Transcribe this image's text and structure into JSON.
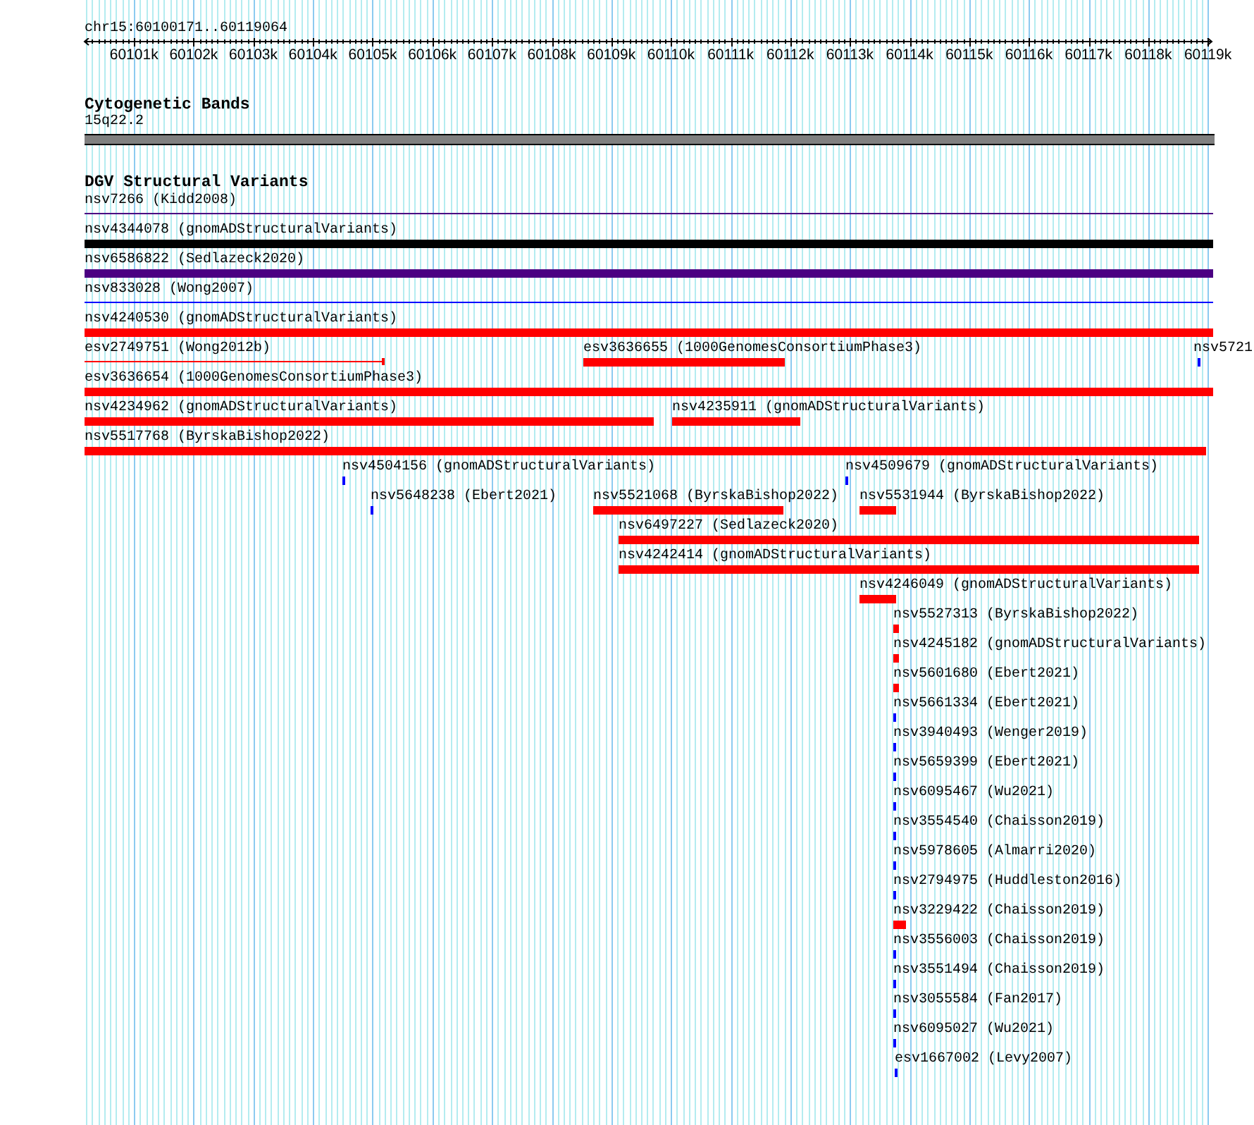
{
  "region": "chr15:60100171..60119064",
  "ruler": {
    "ticks": [
      "60101k",
      "60102k",
      "60103k",
      "60104k",
      "60105k",
      "60106k",
      "60107k",
      "60108k",
      "60109k",
      "60110k",
      "60111k",
      "60112k",
      "60113k",
      "60114k",
      "60115k",
      "60116k",
      "60117k",
      "60118k",
      "60119k"
    ]
  },
  "cytogenetic_bands": {
    "title": "Cytogenetic Bands",
    "band": {
      "label": "15q22.2"
    }
  },
  "variants": {
    "title": "DGV Structural Variants",
    "rows": [
      {
        "features": [
          {
            "label": "nsv7266 (Kidd2008)",
            "kind": "line",
            "color": "#4b0082"
          }
        ]
      },
      {
        "features": [
          {
            "label": "nsv4344078 (gnomADStructuralVariants)",
            "kind": "bar",
            "color": "#000000"
          }
        ]
      },
      {
        "features": [
          {
            "label": "nsv6586822 (Sedlazeck2020)",
            "kind": "bar",
            "color": "#4b0082"
          }
        ]
      },
      {
        "features": [
          {
            "label": "nsv833028 (Wong2007)",
            "kind": "line",
            "color": "#0000ff"
          }
        ]
      },
      {
        "features": [
          {
            "label": "nsv4240530 (gnomADStructuralVariants)",
            "kind": "bar",
            "color": "#ff0000"
          }
        ]
      },
      {
        "features": [
          {
            "label": "esv2749751 (Wong2012b)",
            "kind": "span",
            "color": "#ff0000"
          },
          {
            "label": "esv3636655 (1000GenomesConsortiumPhase3)",
            "kind": "bar",
            "color": "#ff0000"
          },
          {
            "label": "nsv5721",
            "kind": "tick",
            "color": "#0000ff"
          }
        ]
      },
      {
        "features": [
          {
            "label": "esv3636654 (1000GenomesConsortiumPhase3)",
            "kind": "bar",
            "color": "#ff0000"
          }
        ]
      },
      {
        "features": [
          {
            "label": "nsv4234962 (gnomADStructuralVariants)",
            "kind": "bar",
            "color": "#ff0000"
          },
          {
            "label": "nsv4235911 (gnomADStructuralVariants)",
            "kind": "bar",
            "color": "#ff0000"
          }
        ]
      },
      {
        "features": [
          {
            "label": "nsv5517768 (ByrskaBishop2022)",
            "kind": "bar",
            "color": "#ff0000"
          }
        ]
      },
      {
        "features": [
          {
            "label": "nsv4504156 (gnomADStructuralVariants)",
            "kind": "tick",
            "color": "#0000ff"
          },
          {
            "label": "nsv4509679 (gnomADStructuralVariants)",
            "kind": "tick",
            "color": "#0000ff"
          }
        ]
      },
      {
        "features": [
          {
            "label": "nsv5648238 (Ebert2021)",
            "kind": "tick",
            "color": "#0000ff"
          },
          {
            "label": "nsv5521068 (ByrskaBishop2022)",
            "kind": "bar",
            "color": "#ff0000"
          },
          {
            "label": "nsv5531944 (ByrskaBishop2022)",
            "kind": "bar",
            "color": "#ff0000"
          }
        ]
      },
      {
        "features": [
          {
            "label": "nsv6497227 (Sedlazeck2020)",
            "kind": "bar",
            "color": "#ff0000"
          }
        ]
      },
      {
        "features": [
          {
            "label": "nsv4242414 (gnomADStructuralVariants)",
            "kind": "bar",
            "color": "#ff0000"
          }
        ]
      },
      {
        "features": [
          {
            "label": "nsv4246049 (gnomADStructuralVariants)",
            "kind": "bar",
            "color": "#ff0000"
          }
        ]
      },
      {
        "features": [
          {
            "label": "nsv5527313 (ByrskaBishop2022)",
            "kind": "bar",
            "color": "#ff0000"
          }
        ]
      },
      {
        "features": [
          {
            "label": "nsv4245182 (gnomADStructuralVariants)",
            "kind": "bar",
            "color": "#ff0000"
          }
        ]
      },
      {
        "features": [
          {
            "label": "nsv5601680 (Ebert2021)",
            "kind": "bar",
            "color": "#ff0000"
          }
        ]
      },
      {
        "features": [
          {
            "label": "nsv5661334 (Ebert2021)",
            "kind": "tick",
            "color": "#0000ff"
          }
        ]
      },
      {
        "features": [
          {
            "label": "nsv3940493 (Wenger2019)",
            "kind": "tick",
            "color": "#0000ff"
          }
        ]
      },
      {
        "features": [
          {
            "label": "nsv5659399 (Ebert2021)",
            "kind": "tick",
            "color": "#0000ff"
          }
        ]
      },
      {
        "features": [
          {
            "label": "nsv6095467 (Wu2021)",
            "kind": "tick",
            "color": "#0000ff"
          }
        ]
      },
      {
        "features": [
          {
            "label": "nsv3554540 (Chaisson2019)",
            "kind": "tick",
            "color": "#0000ff"
          }
        ]
      },
      {
        "features": [
          {
            "label": "nsv5978605 (Almarri2020)",
            "kind": "tick",
            "color": "#0000ff"
          }
        ]
      },
      {
        "features": [
          {
            "label": "nsv2794975 (Huddleston2016)",
            "kind": "tick",
            "color": "#0000ff"
          }
        ]
      },
      {
        "features": [
          {
            "label": "nsv3229422 (Chaisson2019)",
            "kind": "bar",
            "color": "#ff0000"
          }
        ]
      },
      {
        "features": [
          {
            "label": "nsv3556003 (Chaisson2019)",
            "kind": "tick",
            "color": "#0000ff"
          }
        ]
      },
      {
        "features": [
          {
            "label": "nsv3551494 (Chaisson2019)",
            "kind": "tick",
            "color": "#0000ff"
          }
        ]
      },
      {
        "features": [
          {
            "label": "nsv3055584 (Fan2017)",
            "kind": "tick",
            "color": "#0000ff"
          }
        ]
      },
      {
        "features": [
          {
            "label": "nsv6095027 (Wu2021)",
            "kind": "tick",
            "color": "#0000ff"
          }
        ]
      },
      {
        "features": [
          {
            "label": "esv1667002 (Levy2007)",
            "kind": "tick",
            "color": "#0000ff"
          }
        ]
      }
    ]
  }
}
